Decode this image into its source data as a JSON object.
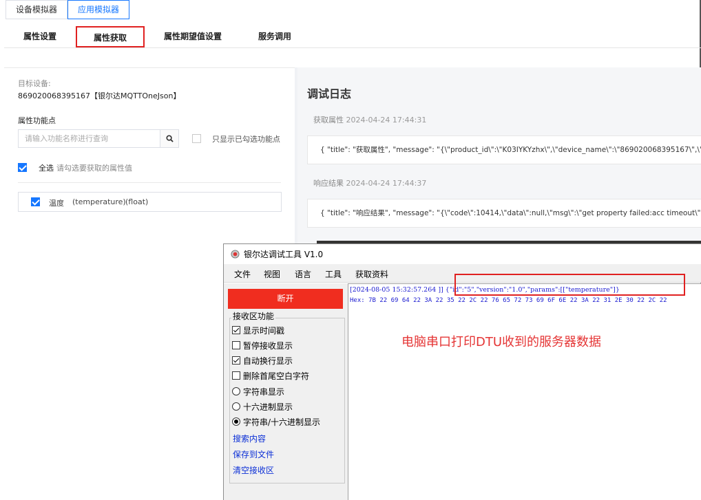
{
  "sim_tabs": [
    {
      "label": "设备模拟器",
      "active": false
    },
    {
      "label": "应用模拟器",
      "active": true
    }
  ],
  "sub_tabs": [
    {
      "label": "属性设置"
    },
    {
      "label": "属性获取"
    },
    {
      "label": "属性期望值设置"
    },
    {
      "label": "服务调用"
    }
  ],
  "left": {
    "target_label": "目标设备:",
    "target_value": "869020068395167【银尔达MQTTOneJson】",
    "feature_label": "属性功能点",
    "search_placeholder": "请输入功能名称进行查询",
    "only_checked_label": "只显示已勾选功能点",
    "select_all_label": "全选",
    "select_all_hint": "请勾选要获取的属性值",
    "property": {
      "name": "温度",
      "id": "(temperature)",
      "type": "(float)",
      "checked": true
    }
  },
  "log": {
    "title": "调试日志",
    "entries": [
      {
        "kind": "获取属性",
        "time": "2024-04-24 17:44:31",
        "content": "{ \"title\": \"获取属性\", \"message\": \"{\\\"product_id\\\":\\\"K03IYKYzhx\\\",\\\"device_name\\\":\\\"869020068395167\\\",\\\"params\\\":"
      },
      {
        "kind": "响应结果",
        "time": "2024-04-24 17:44:37",
        "content": "{ \"title\": \"响应结果\", \"message\": \"{\\\"code\\\":10414,\\\"data\\\":null,\\\"msg\\\":\\\"get property failed:acc timeout\\\",\\\"reques"
      }
    ]
  },
  "tool": {
    "title": "银尔达调试工具 V1.0",
    "menu": [
      "文件",
      "视图",
      "语言",
      "工具",
      "获取资料"
    ],
    "disconnect_label": "断开",
    "group_label": "接收区功能",
    "options": [
      {
        "type": "checkbox",
        "label": "显示时间戳",
        "checked": true
      },
      {
        "type": "checkbox",
        "label": "暂停接收显示",
        "checked": false
      },
      {
        "type": "checkbox",
        "label": "自动换行显示",
        "checked": true
      },
      {
        "type": "checkbox",
        "label": "删除首尾空白字符",
        "checked": false
      },
      {
        "type": "radio",
        "label": "字符串显示",
        "checked": false
      },
      {
        "type": "radio",
        "label": "十六进制显示",
        "checked": false
      },
      {
        "type": "radio",
        "label": "字符串/十六进制显示",
        "checked": true
      }
    ],
    "links": [
      "搜索内容",
      "保存到文件",
      "清空接收区"
    ],
    "recv_line1_prefix": "[2024-08-05 15:32:57.264 ]] ",
    "recv_line1_json": "{\"id\":\"5\",\"version\":\"1.0\",\"params\":[[\"temperature\"]}",
    "recv_line2": "Hex: 7B 22 69 64 22 3A 22 35 22 2C 22 76 65 72 73 69 6F 6E 22 3A 22 31 2E 30 22 2C 22",
    "annotation": "电脑串口打印DTU收到的服务器数据"
  },
  "colors": {
    "accent": "#1677ff",
    "highlight_red": "#e02020",
    "disconnect_red": "#f02d1f",
    "recv_text": "#1a1ad0",
    "link": "#0b2fd6"
  }
}
